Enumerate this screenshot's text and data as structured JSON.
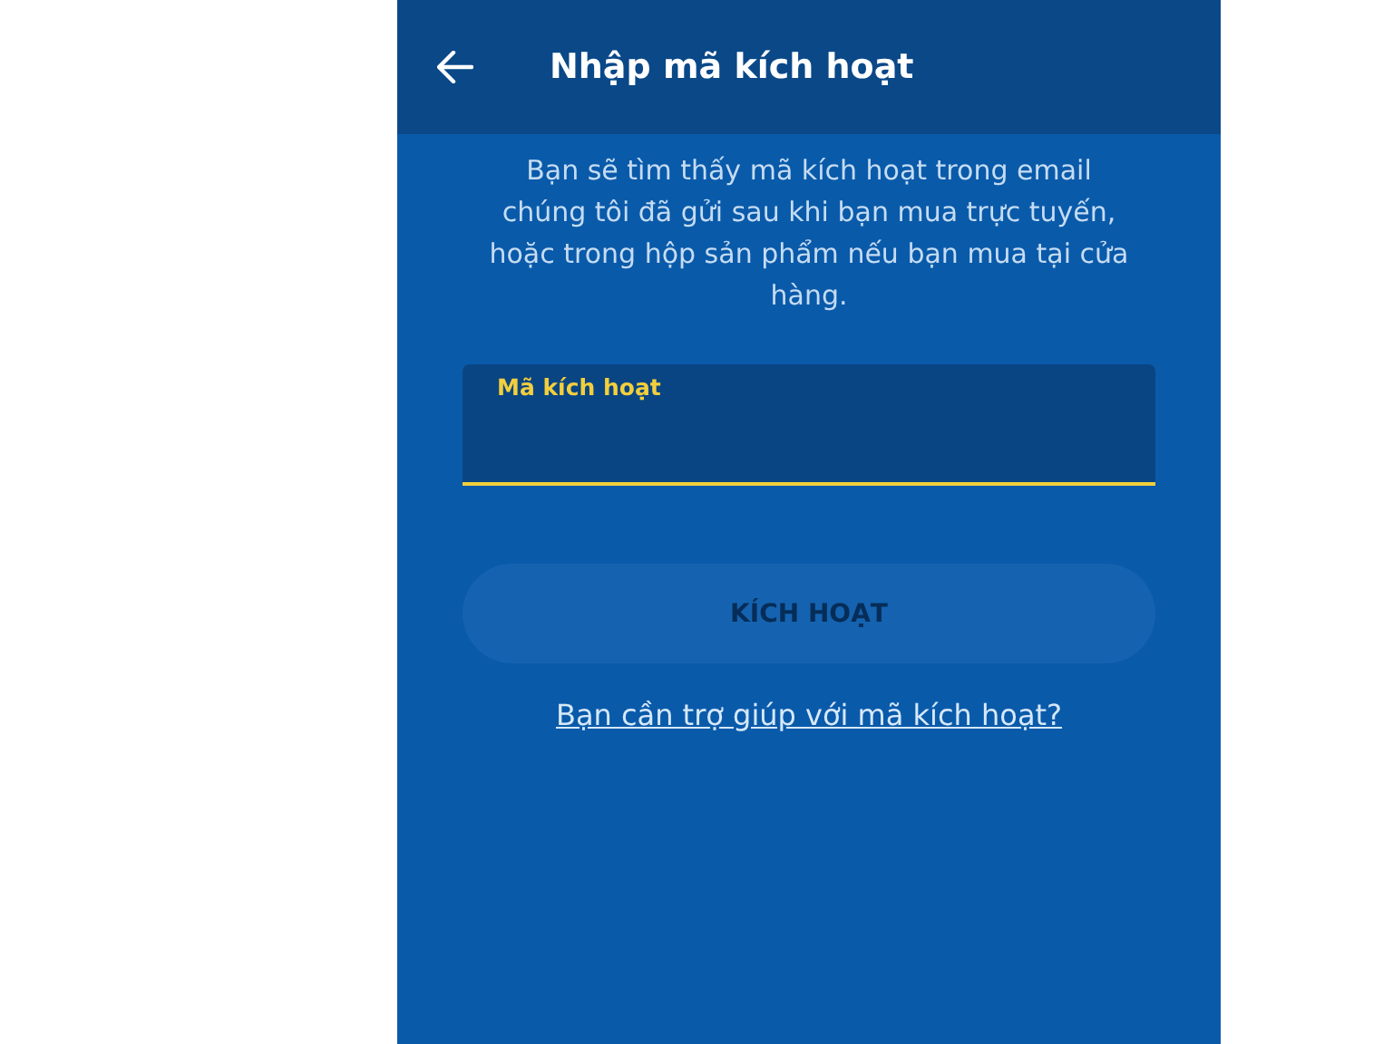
{
  "header": {
    "title": "Nhập mã kích hoạt"
  },
  "description": "Bạn sẽ tìm thấy mã kích hoạt trong email chúng tôi đã gửi sau khi bạn mua trực tuyến, hoặc trong hộp sản phẩm nếu bạn mua tại cửa hàng.",
  "field": {
    "label": "Mã kích hoạt",
    "focused": true
  },
  "button": {
    "label": "KÍCH HOẠT",
    "disabled": true
  },
  "help_link": "Bạn cần trợ giúp với mã kích hoạt?"
}
